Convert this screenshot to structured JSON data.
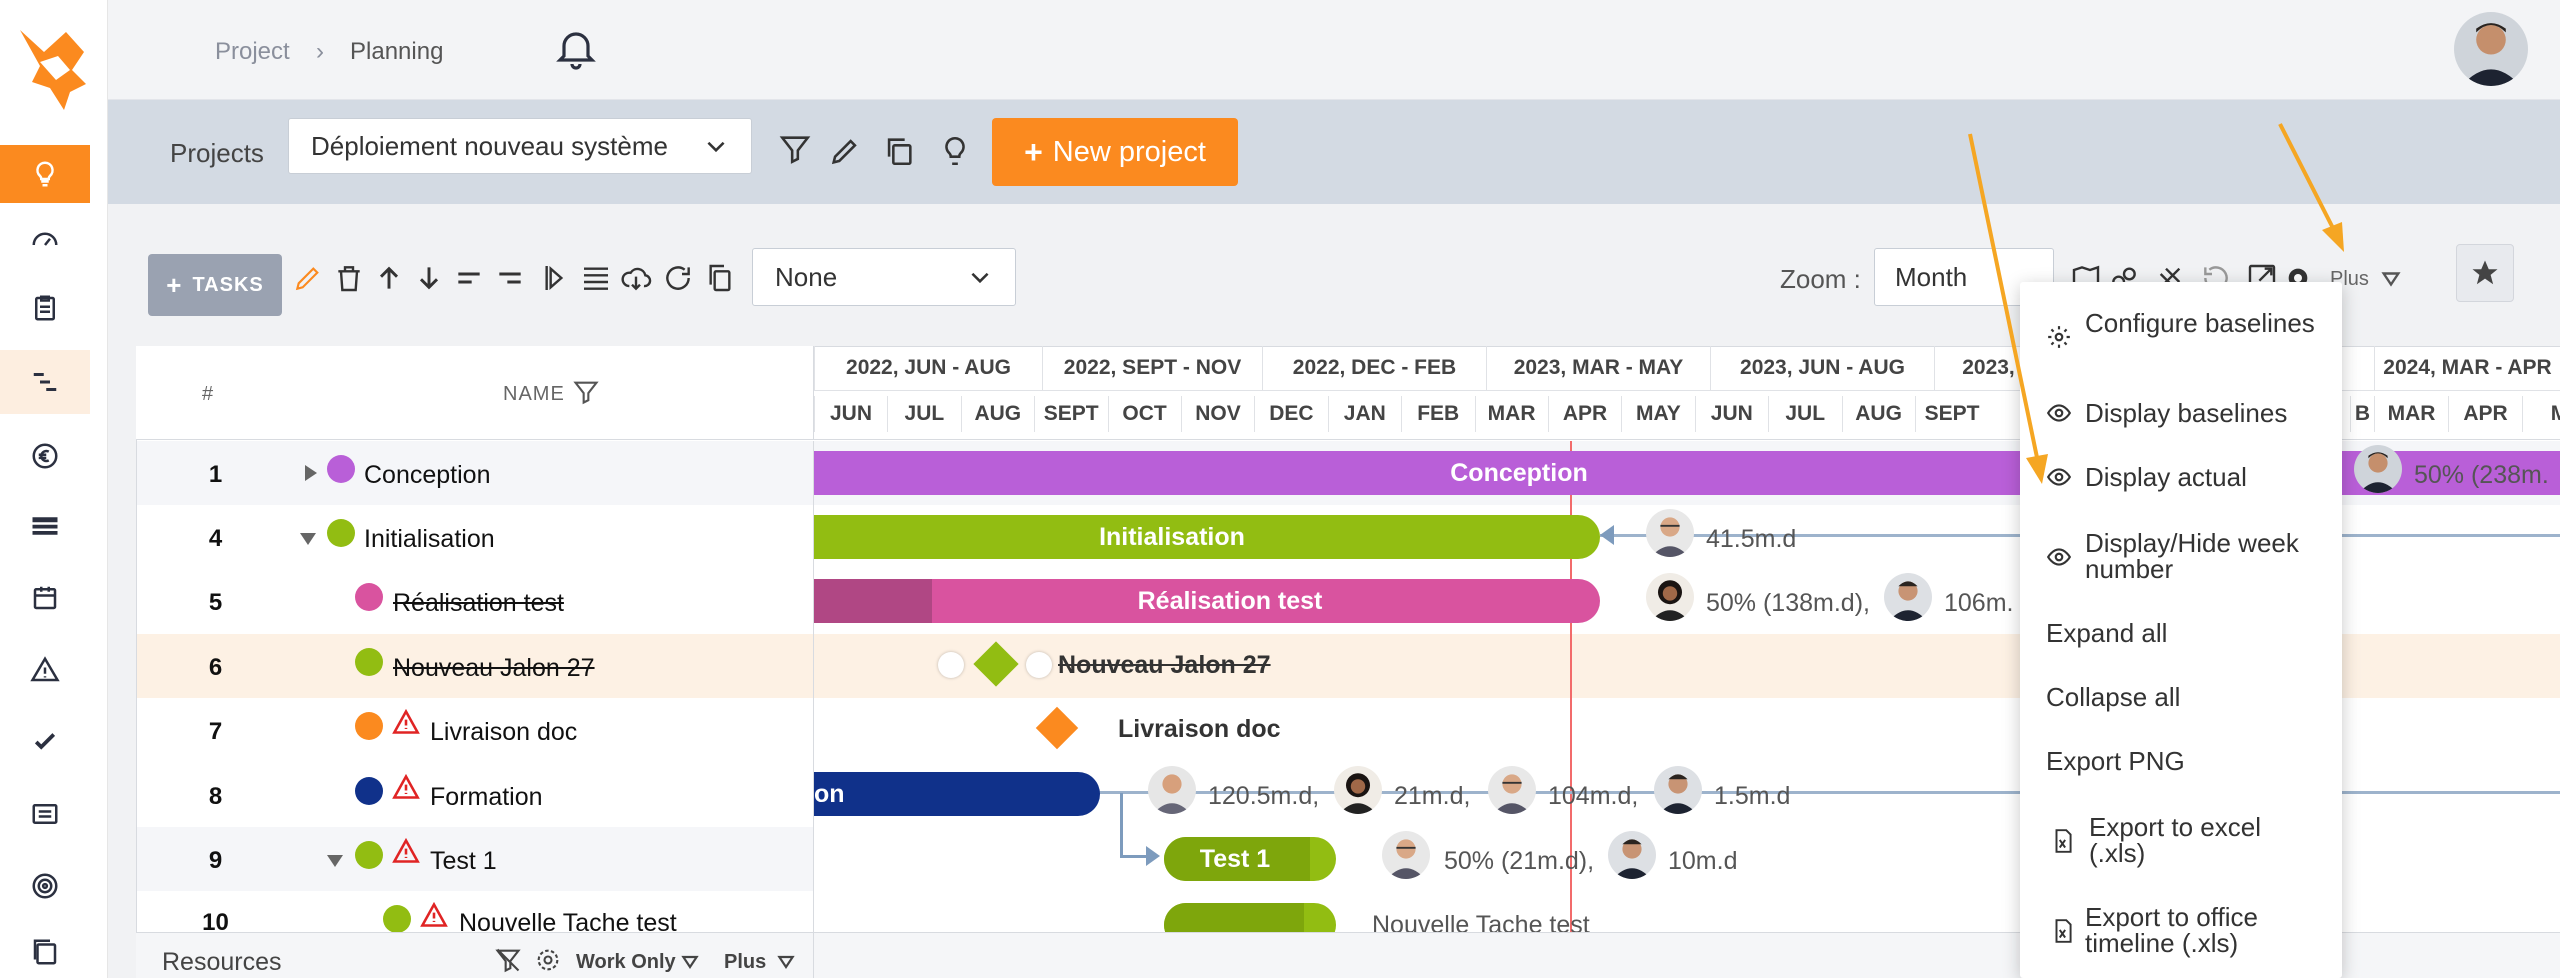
{
  "breadcrumb": {
    "root": "Project",
    "separator": "›",
    "current": "Planning"
  },
  "project_bar": {
    "label": "Projects",
    "selected_project": "Déploiement nouveau système",
    "new_project_label": "New project"
  },
  "tasks_toolbar": {
    "tasks_label": "TASKS",
    "filter_value": "None",
    "zoom_label": "Zoom :",
    "zoom_value": "Month",
    "plus_label": "Plus"
  },
  "grid": {
    "col_number": "#",
    "col_name": "NAME",
    "quarters": [
      "2022, JUN - AUG",
      "2022, SEPT - NOV",
      "2022, DEC - FEB",
      "2023, MAR - MAY",
      "2023, JUN - AUG",
      "2023,",
      "2024, MAR - APR"
    ],
    "months": [
      "JUN",
      "JUL",
      "AUG",
      "SEPT",
      "OCT",
      "NOV",
      "DEC",
      "JAN",
      "FEB",
      "MAR",
      "APR",
      "MAY",
      "JUN",
      "JUL",
      "AUG",
      "SEPT"
    ],
    "months_right": [
      "B",
      "MAR",
      "APR",
      "M"
    ],
    "rows": [
      {
        "num": "1",
        "name": "Conception",
        "color": "#b95fd8"
      },
      {
        "num": "4",
        "name": "Initialisation",
        "color": "#92bd12"
      },
      {
        "num": "5",
        "name": "Réalisation test",
        "color": "#d9539f"
      },
      {
        "num": "6",
        "name": "Nouveau Jalon 27",
        "color": "#92bd12"
      },
      {
        "num": "7",
        "name": "Livraison doc",
        "color": "#fb8a1f"
      },
      {
        "num": "8",
        "name": "Formation",
        "color": "#10318a"
      },
      {
        "num": "9",
        "name": "Test 1",
        "color": "#92bd12"
      },
      {
        "num": "10",
        "name": "Nouvelle Tache test",
        "color": "#92bd12"
      }
    ]
  },
  "gantt": {
    "conception_bar": "Conception",
    "initialisation_bar": "Initialisation",
    "realisation_bar": "Réalisation test",
    "jalon_label": "Nouveau Jalon 27",
    "livraison_label": "Livraison doc",
    "formation_bar": "on",
    "test1_bar": "Test 1",
    "nouvelle_label": "Nouvelle Tache test",
    "conception_right_text": "50% (238m.",
    "init_text": "41.5m.d",
    "real_text1": "50% (138m.d),",
    "real_text2": "106m.",
    "form_text1": "120.5m.d,",
    "form_text2": "21m.d,",
    "form_text3": "104m.d,",
    "form_text4": "1.5m.d",
    "test1_text1": "50% (21m.d),",
    "test1_text2": "10m.d"
  },
  "menu": {
    "items": [
      "Configure baselines",
      "Display baselines",
      "Display actual",
      "Display/Hide week number",
      "Expand all",
      "Collapse all",
      "Export PNG",
      "Export to excel (.xls)",
      "Export to office timeline (.xls)"
    ]
  },
  "resources": {
    "label": "Resources",
    "work_only": "Work Only",
    "plus": "Plus"
  },
  "colors": {
    "accent": "#fb8a1f",
    "conception": "#b95fd8",
    "initialisation": "#92bd12",
    "realisation": "#d9539f",
    "formation": "#10318a",
    "today_line": "#f26b6b",
    "arrow": "#f5a623"
  }
}
